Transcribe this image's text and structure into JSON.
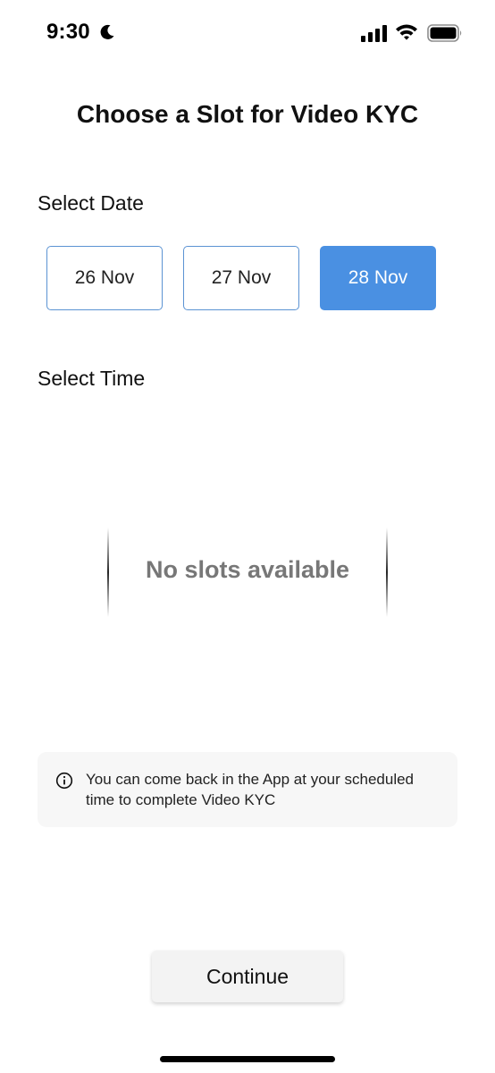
{
  "status_bar": {
    "time": "9:30",
    "icons": [
      "moon-icon",
      "signal-icon",
      "wifi-icon",
      "battery-icon"
    ]
  },
  "page": {
    "title": "Choose a Slot for Video KYC"
  },
  "date_section": {
    "label": "Select Date",
    "dates": [
      {
        "label": "26 Nov",
        "selected": false
      },
      {
        "label": "27 Nov",
        "selected": false
      },
      {
        "label": "28 Nov",
        "selected": true
      }
    ]
  },
  "time_section": {
    "label": "Select Time",
    "empty_message": "No slots available"
  },
  "info": {
    "icon": "info-icon",
    "text": "You can come back in the App at your scheduled time to complete Video KYC"
  },
  "actions": {
    "continue_label": "Continue"
  },
  "colors": {
    "accent": "#4a90e2",
    "chip_border": "#5b93d3",
    "muted_text": "#777777",
    "info_bg": "#f7f7f7"
  }
}
